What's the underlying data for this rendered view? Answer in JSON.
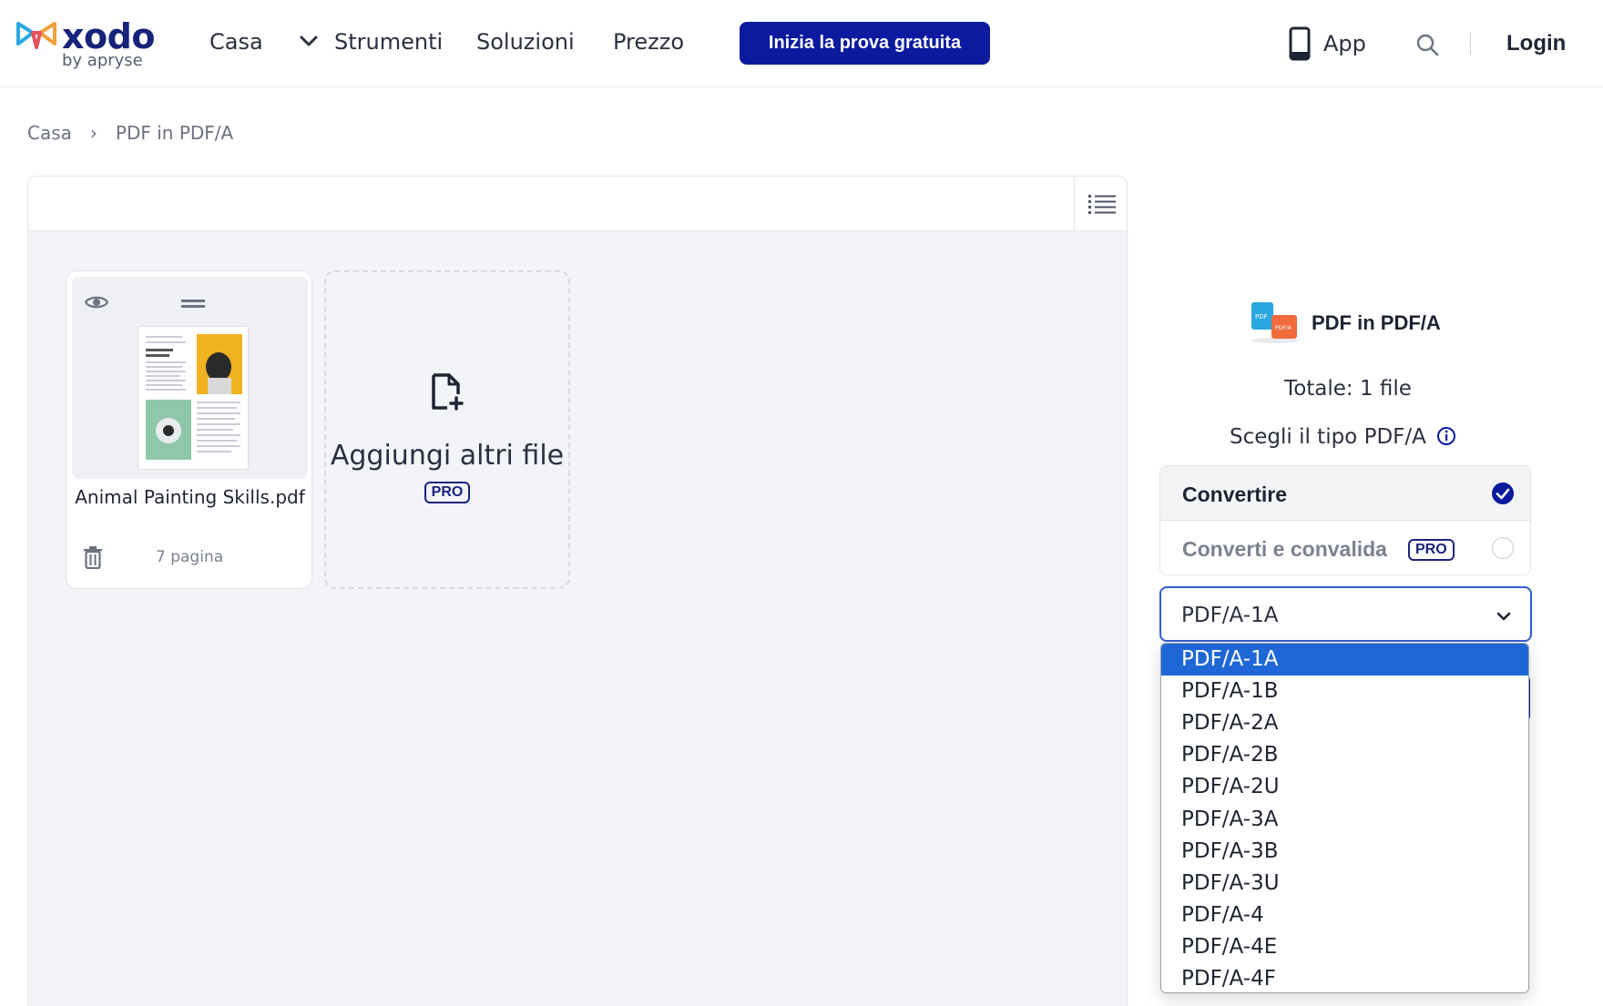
{
  "header": {
    "brand": "xodo",
    "brand_sub": "by apryse",
    "nav": [
      "Casa",
      "Strumenti",
      "Soluzioni",
      "Prezzo"
    ],
    "cta": "Inizia la prova gratuita",
    "app": "App",
    "login": "Login",
    "icons": [
      "search-icon",
      "phone-icon",
      "chevron-down-icon"
    ]
  },
  "breadcrumb": [
    "Casa",
    "PDF in PDF/A"
  ],
  "workspace": {
    "file": {
      "name": "Animal Painting Skills.pdf",
      "pages": "7 pagina"
    },
    "add": {
      "label": "Aggiungi altri file",
      "badge": "PRO"
    }
  },
  "panel": {
    "title": "PDF in PDF/A",
    "total": "Totale: 1 file",
    "choose": "Scegli il tipo PDF/A",
    "options": [
      {
        "label": "Convertire",
        "selected": true
      },
      {
        "label": "Converti e convalida",
        "badge": "PRO",
        "selected": false
      }
    ],
    "select_value": "PDF/A-1A",
    "dropdown": [
      "PDF/A-1A",
      "PDF/A-1B",
      "PDF/A-2A",
      "PDF/A-2B",
      "PDF/A-2U",
      "PDF/A-3A",
      "PDF/A-3B",
      "PDF/A-3U",
      "PDF/A-4",
      "PDF/A-4E",
      "PDF/A-4F"
    ],
    "dropdown_selected_index": 0
  },
  "colors": {
    "primary": "#0b1a9e",
    "highlight": "#1f67d6",
    "focus": "#2f5fd0"
  }
}
